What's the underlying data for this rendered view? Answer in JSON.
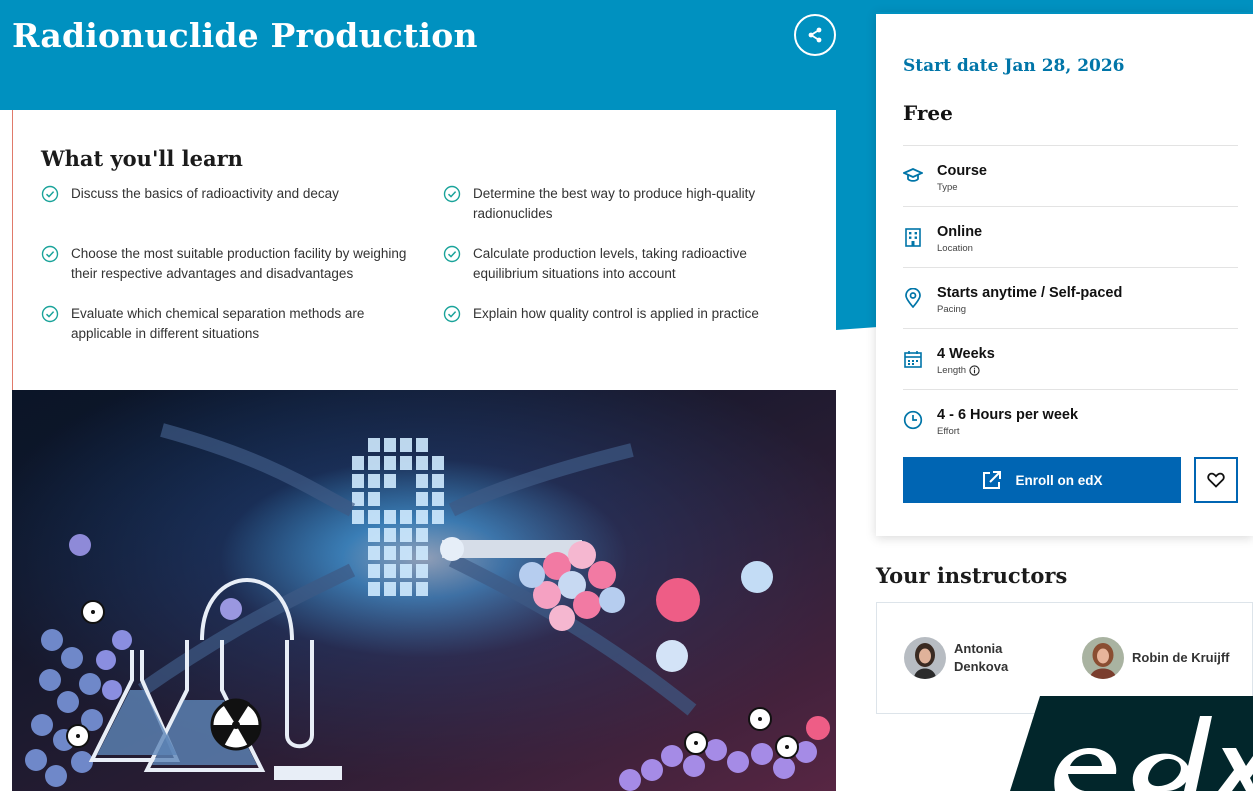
{
  "course": {
    "title": "Radionuclide Production"
  },
  "share": {
    "icon": "share-icon"
  },
  "learn": {
    "heading": "What you'll learn",
    "items": [
      {
        "text": "Discuss the basics of radioactivity and decay"
      },
      {
        "text": "Determine the best way to produce high-quality radionuclides"
      },
      {
        "text": "Choose the most suitable production facility by weighing their respective advantages and disadvantages"
      },
      {
        "text": "Calculate production levels, taking radioactive equilibrium situations into account"
      },
      {
        "text": "Evaluate which chemical separation methods are applicable in different situations"
      },
      {
        "text": "Explain how quality control is applied in practice"
      }
    ]
  },
  "sidebar": {
    "start_date": "Start date Jan 28, 2026",
    "price": "Free",
    "details": [
      {
        "value": "Course",
        "label": "Type",
        "icon": "graduation-cap-icon"
      },
      {
        "value": "Online",
        "label": "Location",
        "icon": "building-icon"
      },
      {
        "value": "Starts anytime / Self-paced",
        "label": "Pacing",
        "icon": "location-pin-icon"
      },
      {
        "value": "4 Weeks",
        "label": "Length",
        "icon": "calendar-icon"
      },
      {
        "value": "4 - 6 Hours per week",
        "label": "Effort",
        "icon": "clock-icon"
      }
    ],
    "enroll_label": "Enroll on edX",
    "favorite_icon": "heart-icon"
  },
  "instructors": {
    "heading": "Your instructors",
    "people": [
      {
        "name_line1": "Antonia",
        "name_line2": "Denkova"
      },
      {
        "name_line1": "Robin de Kruijff",
        "name_line2": ""
      }
    ]
  },
  "brand": {
    "logo_text": "edX"
  },
  "colors": {
    "hero": "#0091c0",
    "primary_button": "#0065b3",
    "start_date": "#0075a8",
    "check": "#1aa39a"
  }
}
